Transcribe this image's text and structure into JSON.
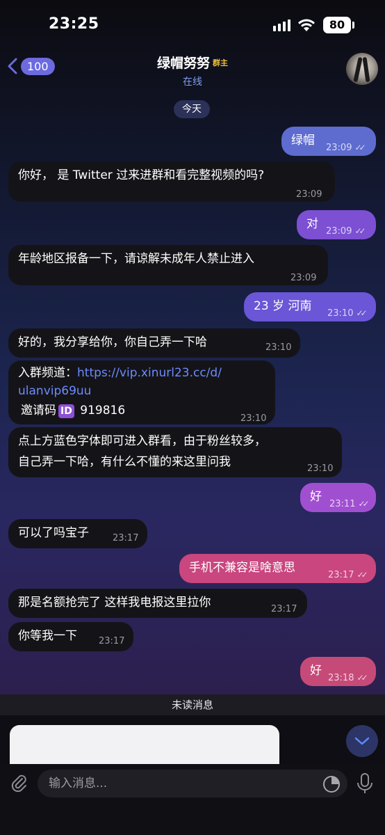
{
  "status_bar": {
    "time": "23:25",
    "battery": "80"
  },
  "header": {
    "back_count": "100",
    "title": "绿帽努努",
    "owner_badge": "群主",
    "subtitle": "在线"
  },
  "date_label": "今天",
  "messages": [
    {
      "text": "绿帽",
      "time": "23:09",
      "ticks": "✓✓"
    },
    {
      "text": "你好， 是 Twitter 过来进群和看完整视频的吗?",
      "time": "23:09"
    },
    {
      "text": "对",
      "time": "23:09",
      "ticks": "✓✓"
    },
    {
      "text": "年龄地区报备一下，请谅解未成年人禁止进入",
      "time": "23:09"
    },
    {
      "text": "23 岁 河南",
      "time": "23:10",
      "ticks": "✓✓"
    },
    {
      "text": "好的，我分享给你，你自己弄一下哈",
      "time": "23:10"
    },
    {
      "text_prefix": "入群频道：",
      "link_line1": "https://vip.xinurl23.cc/d/",
      "link_line2": "ulanvip69uu",
      "invite_label": "邀请码",
      "id_icon": "ID",
      "invite_code": "919816",
      "time": "23:10"
    },
    {
      "line1": "点上方蓝色字体即可进入群看，由于粉丝较多，",
      "line2": "自己弄一下哈，有什么不懂的来这里问我",
      "time": "23:10"
    },
    {
      "text": "好",
      "time": "23:11",
      "ticks": "✓✓"
    },
    {
      "text": "可以了吗宝子",
      "time": "23:17"
    },
    {
      "text": "手机不兼容是啥意思",
      "time": "23:17",
      "ticks": "✓✓"
    },
    {
      "text": "那是名额抢完了 这样我电报这里拉你",
      "time": "23:17"
    },
    {
      "text": "你等我一下",
      "time": "23:17"
    },
    {
      "text": "好",
      "time": "23:18",
      "ticks": "✓✓"
    }
  ],
  "unread_label": "未读消息",
  "input": {
    "placeholder": "输入消息..."
  },
  "colors": {
    "outgoing_blue": "#5e6ccf",
    "outgoing_purple": "#7c4fd3",
    "outgoing_pink": "#c9467f",
    "incoming": "#141418",
    "link": "#6d8bff"
  }
}
